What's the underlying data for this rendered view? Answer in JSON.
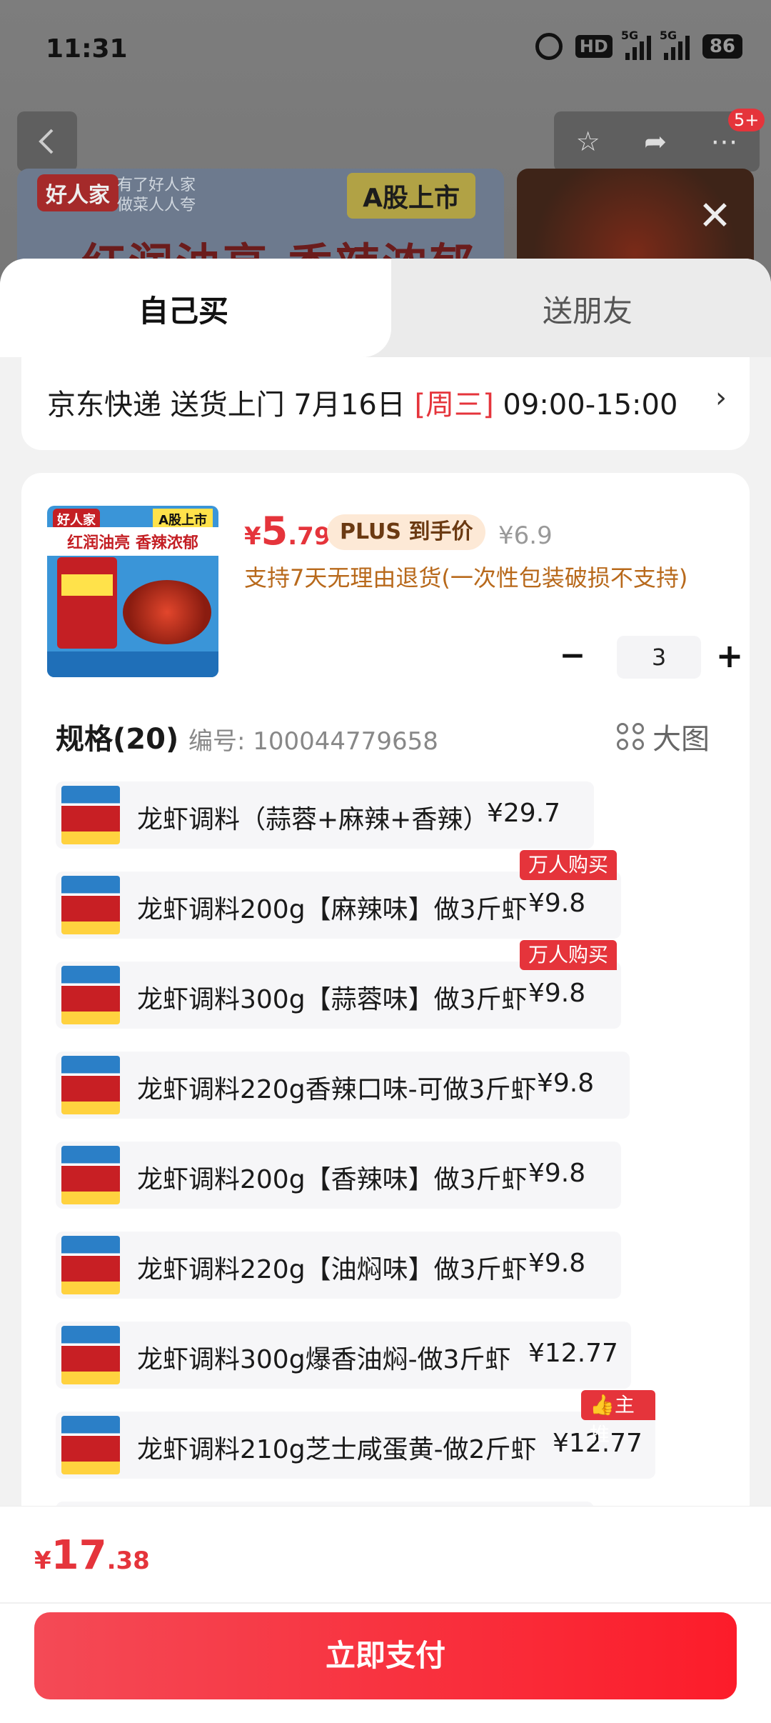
{
  "status_bar": {
    "time": "11:31",
    "hd_label": "HD",
    "signal_1": "5G",
    "signal_2": "5G",
    "battery": "86"
  },
  "background": {
    "brand": "好人家",
    "tagline_1": "有了好人家",
    "tagline_2": "做菜人人夸",
    "ipo_label": "A股上市",
    "slogan": "红润油亮 香辣浓郁",
    "cart_badge": "5+"
  },
  "tabs": {
    "self": "自己买",
    "gift": "送朋友"
  },
  "delivery": {
    "carrier": "京东快递 送货上门 7月16日 ",
    "weekday": "[周三]",
    "window": " 09:00-15:00",
    "chevron": "›"
  },
  "product": {
    "image_brand": "好人家",
    "image_ipo": "A股上市",
    "image_slogan": "红润油亮 香辣浓郁",
    "price_currency": "¥",
    "price_int": "5",
    "price_dec": ".79",
    "plus_tag": "PLUS 到手价",
    "original_price": "¥6.9",
    "return_policy": "支持7天无理由退货(一次性包装破损不支持)",
    "quantity": "3"
  },
  "specs": {
    "title": "规格(20)",
    "sku": "编号: 100044779658",
    "large_view": "大图",
    "variants": [
      {
        "label": "龙虾调料（蒜蓉+麻辣+香辣）",
        "price": "¥29.7",
        "tag": ""
      },
      {
        "label": "龙虾调料200g【麻辣味】做3斤虾",
        "price": "¥9.8",
        "tag": "万人购买"
      },
      {
        "label": "龙虾调料300g【蒜蓉味】做3斤虾",
        "price": "¥9.8",
        "tag": "万人购买"
      },
      {
        "label": "龙虾调料220g香辣口味-可做3斤虾",
        "price": "¥9.8",
        "tag": ""
      },
      {
        "label": "龙虾调料200g【香辣味】做3斤虾",
        "price": "¥9.8",
        "tag": ""
      },
      {
        "label": "龙虾调料220g【油焖味】做3斤虾",
        "price": "¥9.8",
        "tag": ""
      },
      {
        "label": "龙虾调料300g爆香油焖-做3斤虾",
        "price": "¥12.77",
        "tag": ""
      },
      {
        "label": "龙虾调料210g芝士咸蛋黄-做2斤虾",
        "price": "¥12.77",
        "tag": "主推"
      }
    ]
  },
  "footer": {
    "total_currency": "¥",
    "total_int": "17",
    "total_dec": ".38",
    "pay_button": "立即支付"
  },
  "colors": {
    "accent": "#e5343b",
    "plus_bg": "#fde9d6",
    "return_text": "#b8691b"
  },
  "icons": [
    "back-icon",
    "favorite-star-icon",
    "share-icon",
    "more-icon",
    "close-icon",
    "chevron-right-icon",
    "minus-icon",
    "plus-icon",
    "grid-view-icon",
    "thumbs-up-icon"
  ]
}
